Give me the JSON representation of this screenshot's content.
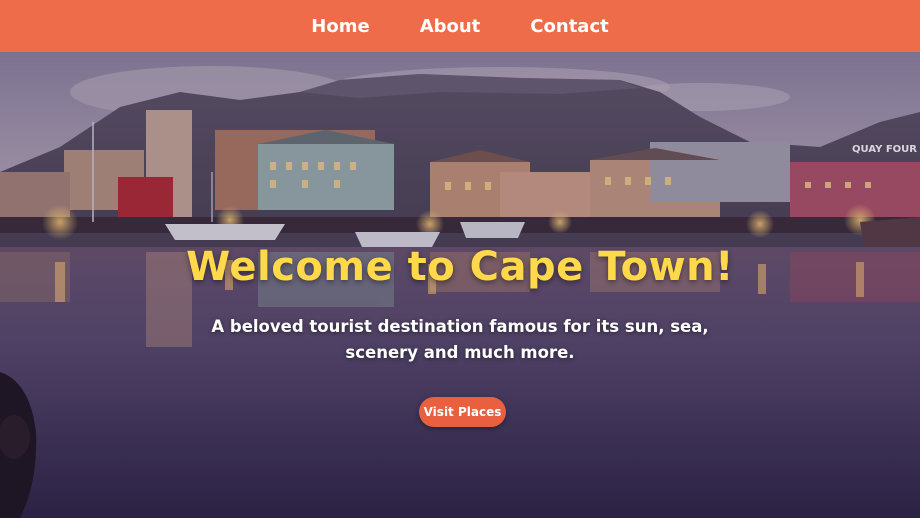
{
  "nav": {
    "links": [
      {
        "label": "Home"
      },
      {
        "label": "About"
      },
      {
        "label": "Contact"
      }
    ]
  },
  "hero": {
    "title": "Welcome to Cape Town!",
    "subtitle": "A beloved tourist destination famous for its sun, sea, scenery and much more.",
    "button_label": "Visit Places",
    "background": "cape-town-waterfront-photo",
    "sign_text": "QUAY FOUR"
  },
  "colors": {
    "nav_bg": "#ef6c4a",
    "title": "#ffd94a",
    "button_bg": "#e8603f",
    "text": "#ffffff"
  }
}
